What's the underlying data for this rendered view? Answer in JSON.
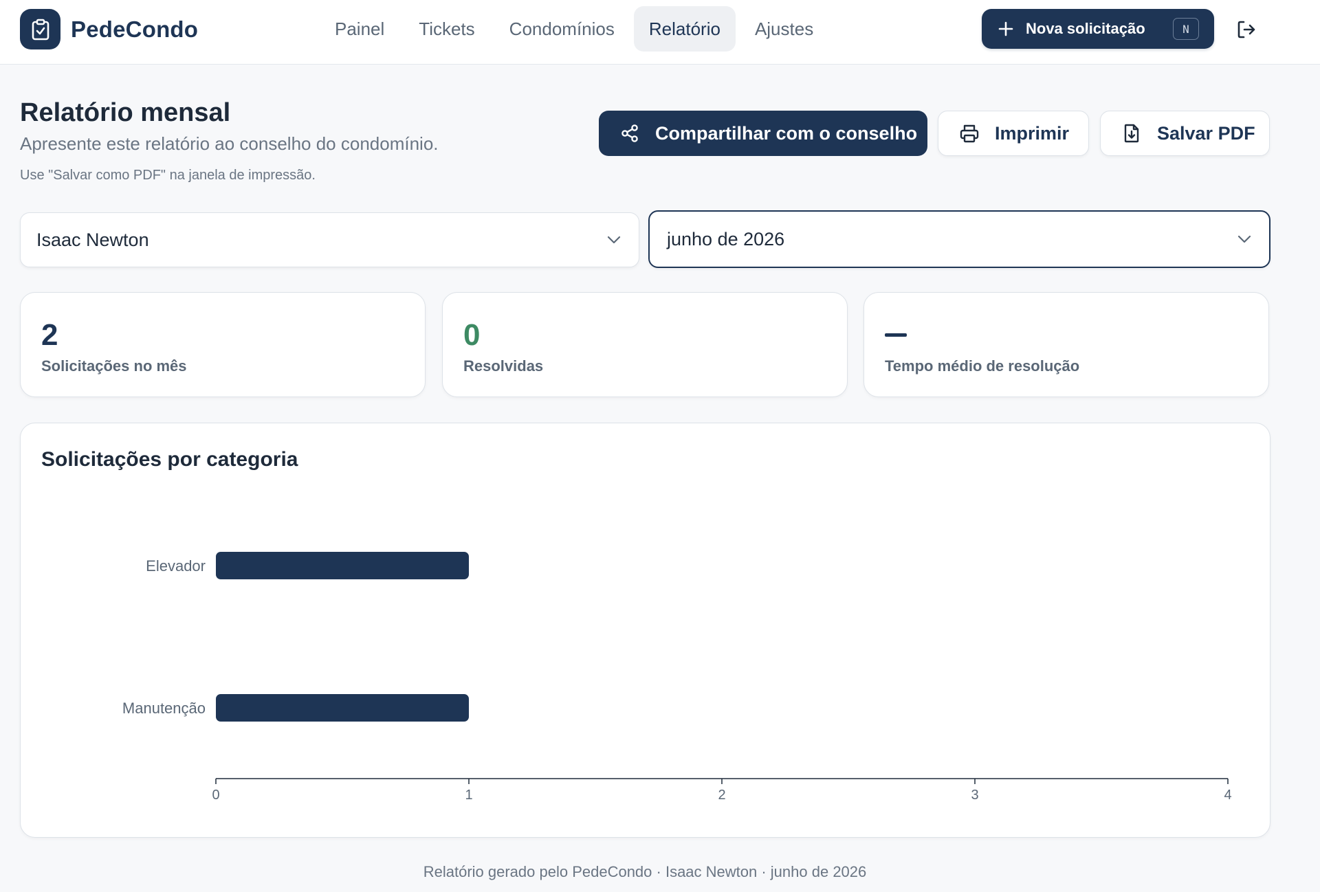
{
  "brand": {
    "name": "PedeCondo",
    "logo_icon": "clipboard-check-icon"
  },
  "nav": {
    "items": [
      {
        "label": "Painel",
        "active": false
      },
      {
        "label": "Tickets",
        "active": false
      },
      {
        "label": "Condomínios",
        "active": false
      },
      {
        "label": "Relatório",
        "active": true
      },
      {
        "label": "Ajustes",
        "active": false
      }
    ]
  },
  "new_request": {
    "label": "Nova solicitação",
    "shortcut": "N",
    "icon": "plus-icon"
  },
  "logout": {
    "icon": "logout-icon"
  },
  "header": {
    "title": "Relatório mensal",
    "subtitle": "Apresente este relatório ao conselho do condomínio.",
    "hint": "Use \"Salvar como PDF\" na janela de impressão."
  },
  "actions": {
    "share_label": "Compartilhar com o conselho",
    "print_label": "Imprimir",
    "pdf_label": "Salvar PDF"
  },
  "filters": {
    "resident": "Isaac Newton",
    "month": "junho de 2026"
  },
  "stats": [
    {
      "value": "2",
      "label": "Solicitações no mês"
    },
    {
      "value": "0",
      "label": "Resolvidas"
    },
    {
      "value": "",
      "label": "Tempo médio de resolução"
    }
  ],
  "chart_data": {
    "type": "bar",
    "orientation": "horizontal",
    "title": "Solicitações por categoria",
    "categories": [
      "Elevador",
      "Manutenção"
    ],
    "values": [
      1,
      1
    ],
    "xlim": [
      0,
      4
    ],
    "xticks": [
      0,
      1,
      2,
      3,
      4
    ],
    "xlabel": "",
    "ylabel": "",
    "grid": false,
    "bar_color": "#1e3555"
  },
  "footer": {
    "text": "Relatório gerado pelo PedeCondo · Isaac Newton · junho de 2026"
  },
  "colors": {
    "primary": "#1e3555",
    "success": "#3d8a63",
    "muted": "#6a7583"
  }
}
